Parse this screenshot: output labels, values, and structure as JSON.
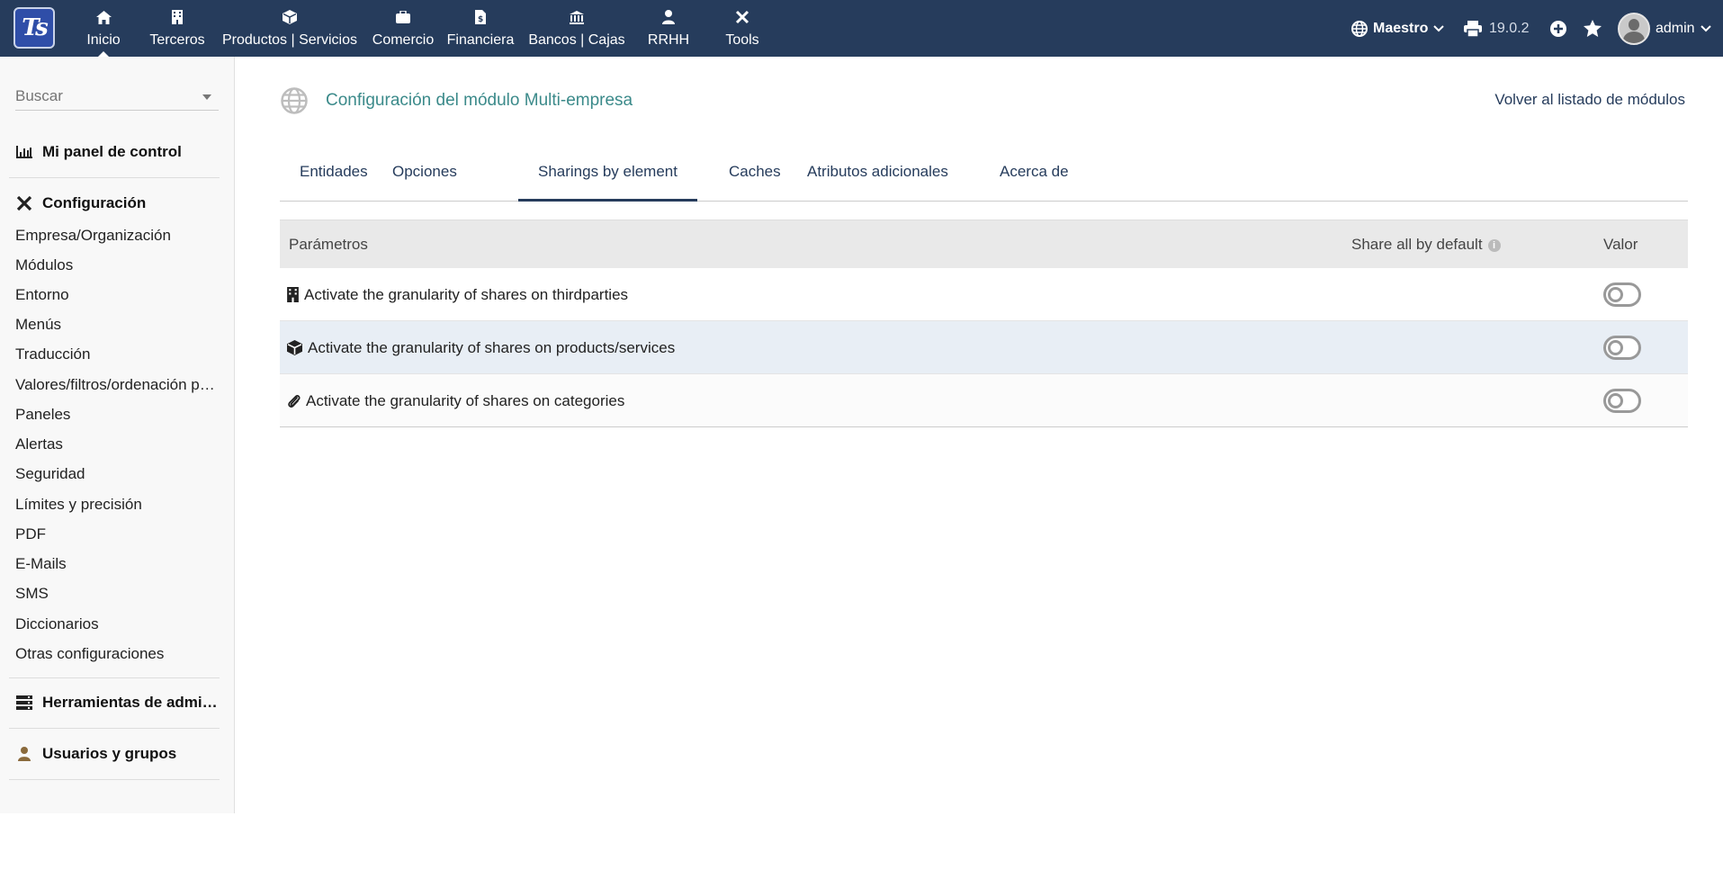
{
  "app": {
    "logo_text": "Ts"
  },
  "topnav": [
    {
      "label": "Inicio",
      "icon": "home-icon",
      "active": true
    },
    {
      "label": "Terceros",
      "icon": "building-icon"
    },
    {
      "label": "Productos | Servicios",
      "icon": "cube-icon"
    },
    {
      "label": "Comercio",
      "icon": "briefcase-icon"
    },
    {
      "label": "Financiera",
      "icon": "invoice-icon"
    },
    {
      "label": "Bancos | Cajas",
      "icon": "bank-icon"
    },
    {
      "label": "RRHH",
      "icon": "person-icon"
    },
    {
      "label": "Tools",
      "icon": "tools-icon"
    }
  ],
  "topright": {
    "entity": "Maestro",
    "version": "19.0.2",
    "user": "admin"
  },
  "sidebar": {
    "search_placeholder": "Buscar",
    "panel": "Mi panel de control",
    "config_head": "Configuración",
    "config_items": [
      "Empresa/Organización",
      "Módulos",
      "Entorno",
      "Menús",
      "Traducción",
      "Valores/filtros/ordenación por defecto",
      "Paneles",
      "Alertas",
      "Seguridad",
      "Límites y precisión",
      "PDF",
      "E-Mails",
      "SMS",
      "Diccionarios",
      "Otras configuraciones"
    ],
    "admin_tools": "Herramientas de administración",
    "users_groups": "Usuarios y grupos"
  },
  "main": {
    "title": "Configuración del módulo Multi-empresa",
    "back_link": "Volver al listado de módulos",
    "tabs": [
      "Entidades",
      "Opciones",
      "Sharings by element",
      "Caches",
      "Atributos adicionales",
      "Acerca de"
    ],
    "active_tab": "Sharings by element",
    "table": {
      "col_params": "Parámetros",
      "col_share": "Share all by default",
      "col_value": "Valor",
      "rows": [
        {
          "label": "Activate the granularity of shares on thirdparties",
          "icon": "building-icon",
          "enabled": false
        },
        {
          "label": "Activate the granularity of shares on products/services",
          "icon": "cube-icon",
          "enabled": false
        },
        {
          "label": "Activate the granularity of shares on categories",
          "icon": "paperclip-icon",
          "enabled": false
        }
      ]
    }
  },
  "colors": {
    "topbar": "#263c5c",
    "title_teal": "#3b8a8a",
    "row_highlight": "#e8eef5"
  }
}
